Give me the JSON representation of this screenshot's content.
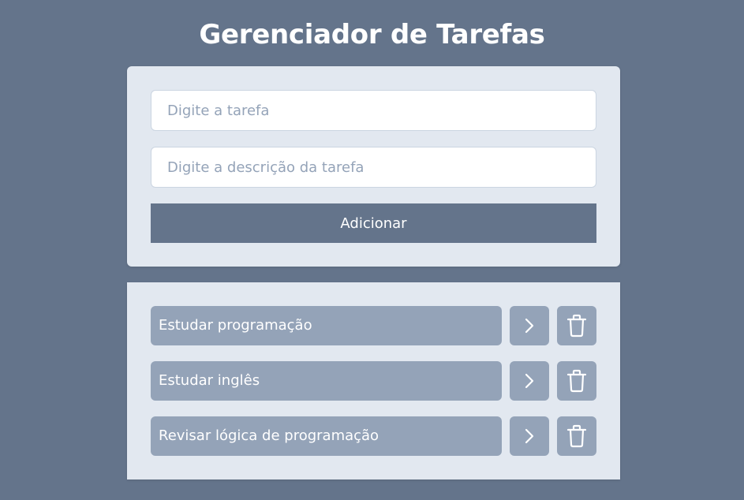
{
  "header": {
    "title": "Gerenciador de Tarefas"
  },
  "form": {
    "task_placeholder": "Digite a tarefa",
    "task_value": "",
    "description_placeholder": "Digite a descrição da tarefa",
    "description_value": "",
    "add_label": "Adicionar"
  },
  "tasks": [
    {
      "title": "Estudar programação",
      "detail_icon": "chevron-right-icon",
      "delete_icon": "trash-icon"
    },
    {
      "title": "Estudar inglês",
      "detail_icon": "chevron-right-icon",
      "delete_icon": "trash-icon"
    },
    {
      "title": "Revisar lógica de programação",
      "detail_icon": "chevron-right-icon",
      "delete_icon": "trash-icon"
    }
  ],
  "colors": {
    "background": "#64748b",
    "card": "#e2e8f0",
    "item": "#94a3b8",
    "button": "#64748b",
    "text_light": "#ffffff"
  }
}
